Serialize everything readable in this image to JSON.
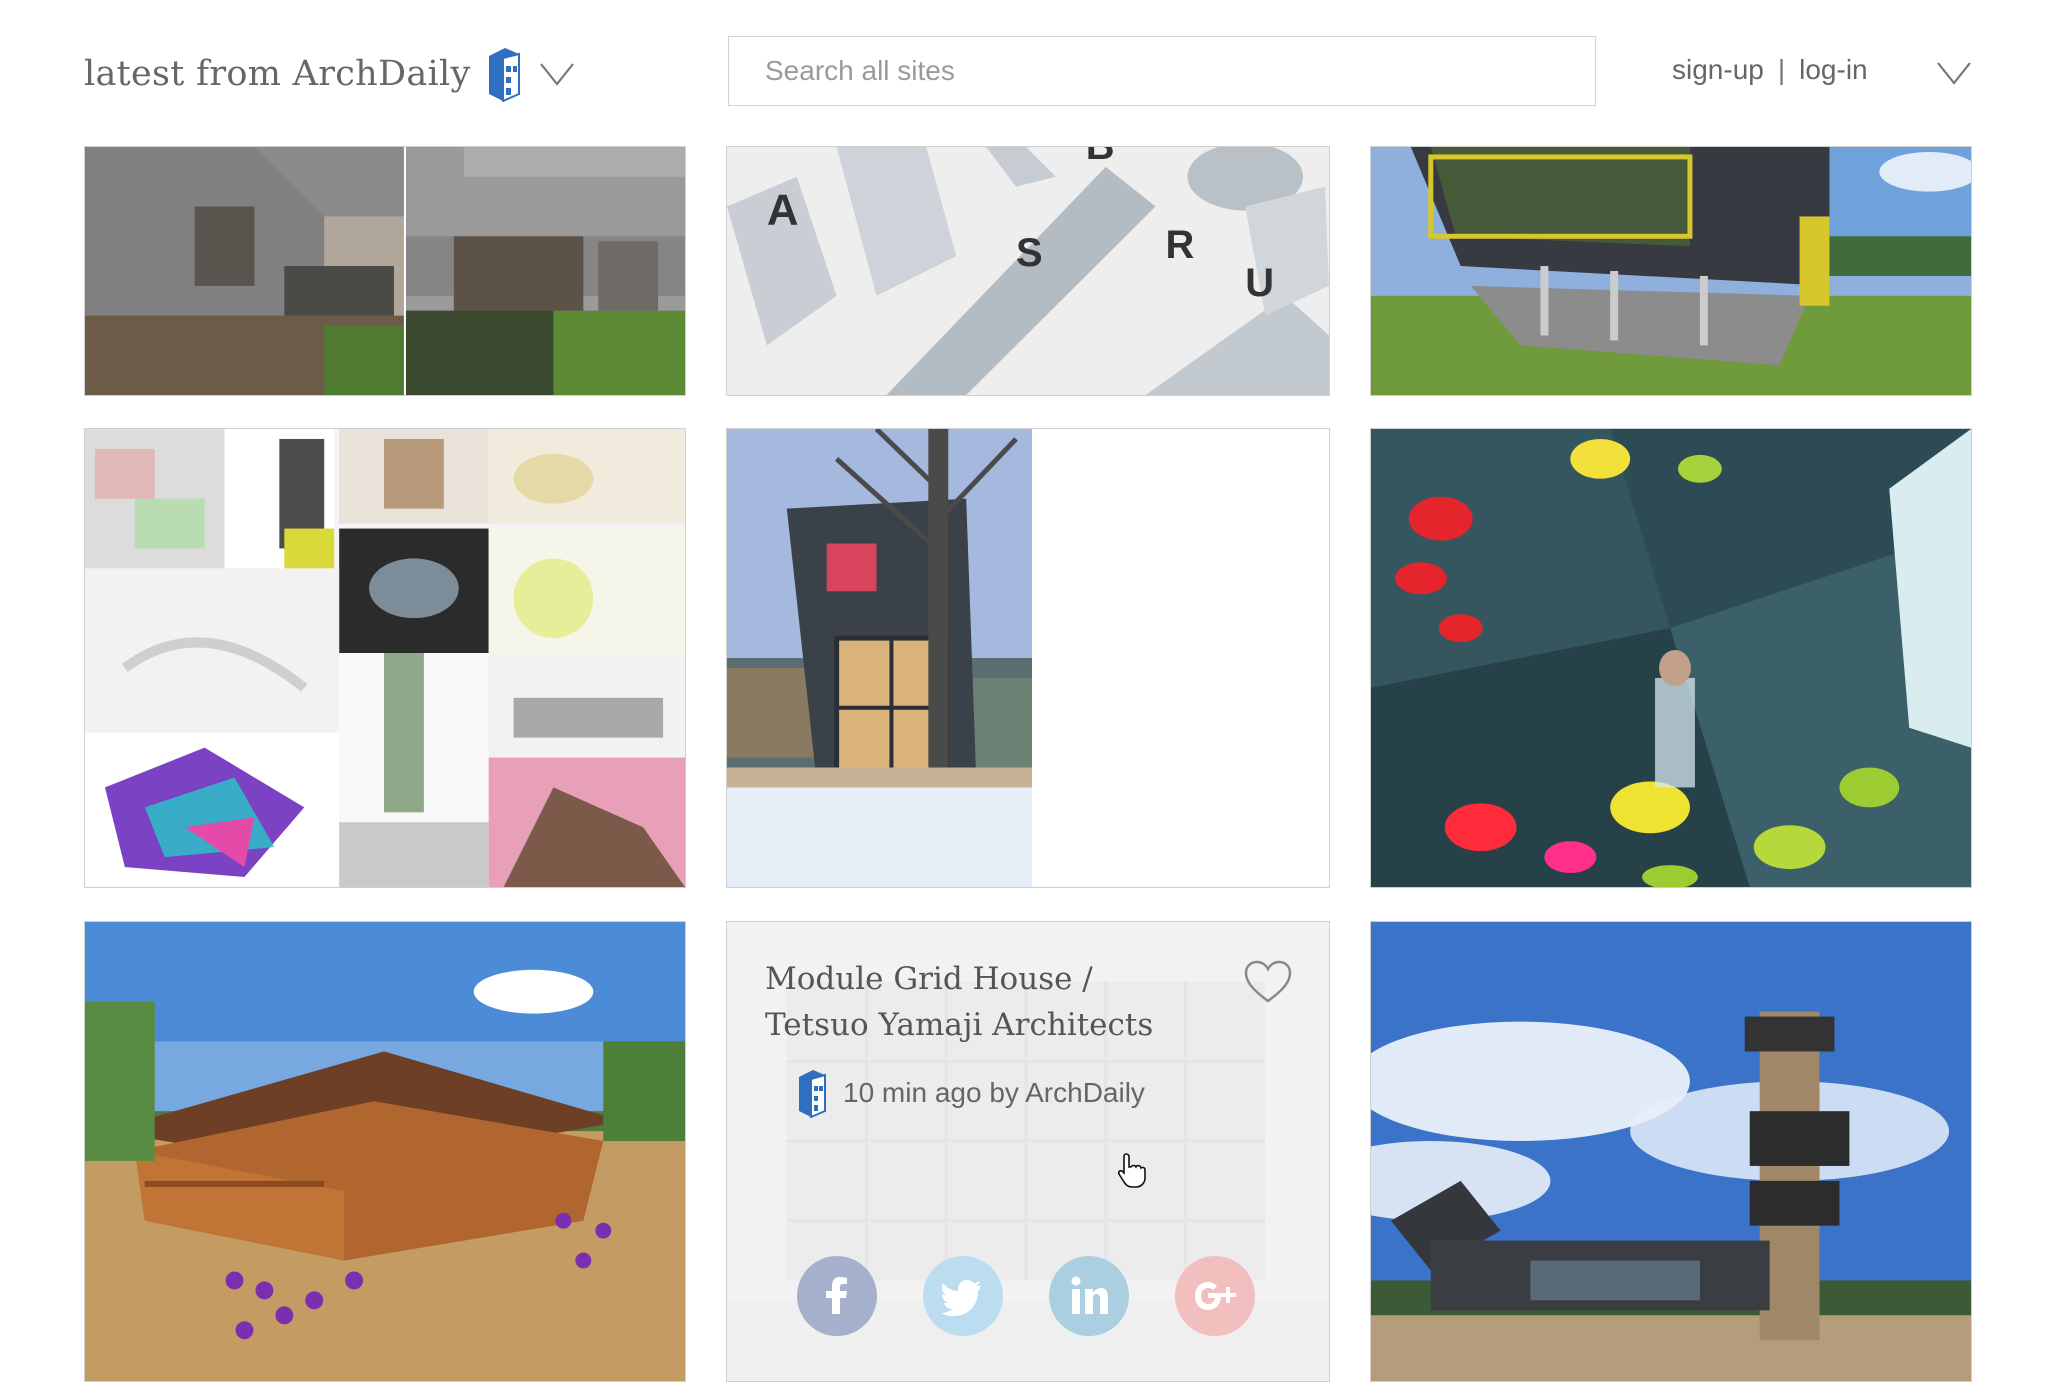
{
  "header": {
    "brand_text": "latest from ArchDaily",
    "search_placeholder": "Search all sites",
    "signup_label": "sign-up",
    "separator": "|",
    "login_label": "log-in"
  },
  "card": {
    "title": "Module Grid House / Tetsuo Yamaji Architects",
    "meta": "10 min ago by ArchDaily"
  },
  "icons": {
    "brand_logo": "archdaily-logo-icon",
    "brand_menu": "chevron-down-icon",
    "user_menu": "chevron-down-icon",
    "favorite": "heart-icon",
    "share": [
      "facebook-icon",
      "twitter-icon",
      "linkedin-icon",
      "google-plus-icon"
    ],
    "pointer": "hand-pointer-icon"
  },
  "colors": {
    "facebook": "#a5b0cc",
    "twitter": "#bcdcef",
    "linkedin": "#a9cfe0",
    "google_plus": "#f3bebe",
    "logo_blue": "#2f6fbf"
  }
}
